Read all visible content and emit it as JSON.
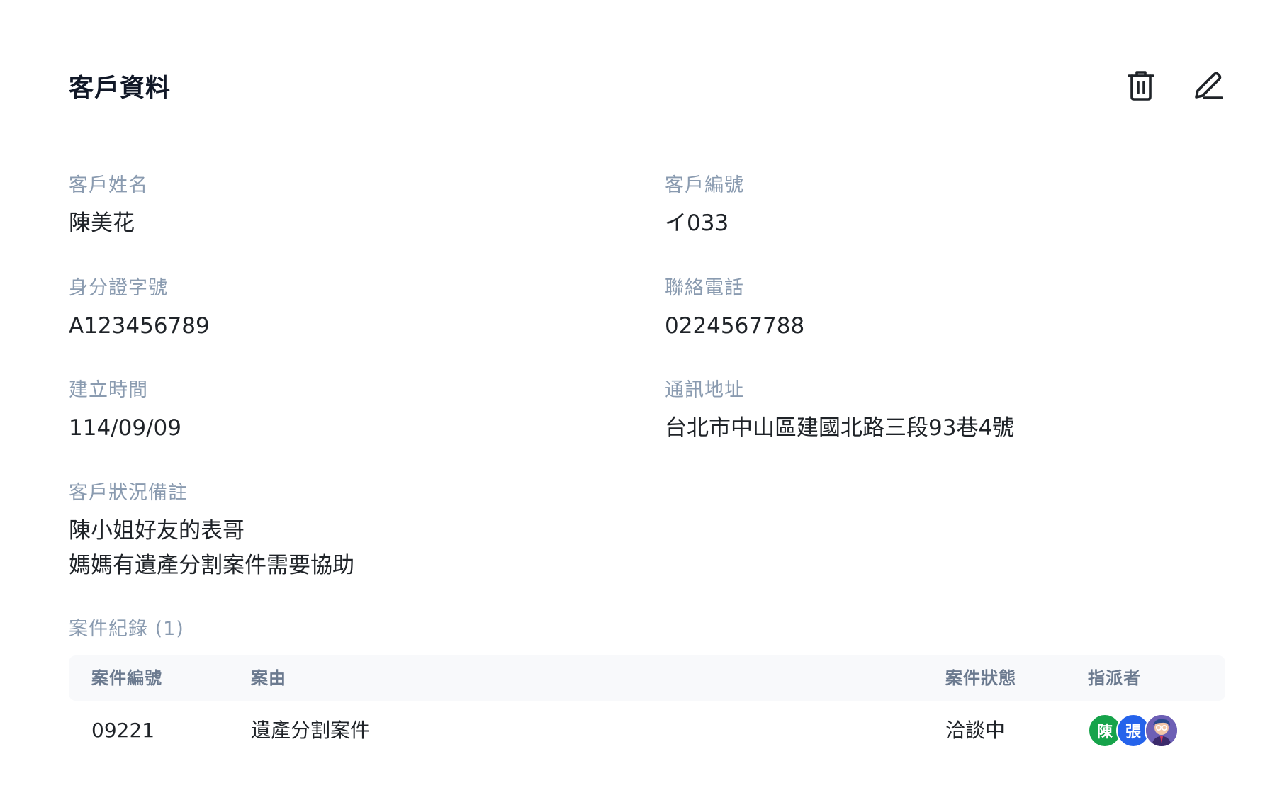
{
  "header": {
    "title": "客戶資料",
    "delete_icon": "trash-icon",
    "edit_icon": "pencil-icon"
  },
  "fields": {
    "name": {
      "label": "客戶姓名",
      "value": "陳美花"
    },
    "client_no": {
      "label": "客戶編號",
      "value": "イ033"
    },
    "id_no": {
      "label": "身分證字號",
      "value": "A123456789"
    },
    "phone": {
      "label": "聯絡電話",
      "value": "0224567788"
    },
    "created": {
      "label": "建立時間",
      "value": "114/09/09"
    },
    "address": {
      "label": "通訊地址",
      "value": "台北市中山區建國北路三段93巷4號"
    },
    "note": {
      "label": "客戶狀況備註",
      "value": "陳小姐好友的表哥\n媽媽有遺產分割案件需要協助"
    }
  },
  "records": {
    "label": "案件紀錄 (1)",
    "columns": [
      "案件編號",
      "案由",
      "案件狀態",
      "指派者"
    ],
    "rows": [
      {
        "case_no": "09221",
        "cause": "遺產分割案件",
        "status": "洽談中",
        "assignees": [
          {
            "initial": "陳",
            "color": "#16a34a"
          },
          {
            "initial": "張",
            "color": "#2563eb"
          },
          {
            "icon": "avatar-photo-icon",
            "color": "#6d5fb5"
          }
        ]
      }
    ]
  }
}
